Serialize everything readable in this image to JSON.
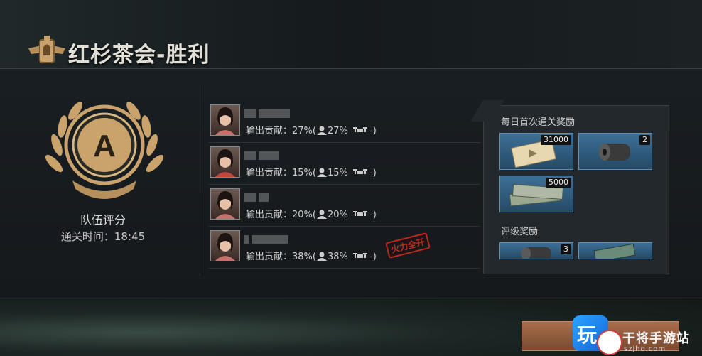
{
  "title": "红杉茶会-胜利",
  "team": {
    "grade": "A",
    "score_label": "队伍评分",
    "clear_time_label": "通关时间：",
    "clear_time": "18:45"
  },
  "players": [
    {
      "contrib_label": "输出贡献：",
      "output_pct": "27%",
      "personal_pct": "27%",
      "drone_val": "-"
    },
    {
      "contrib_label": "输出贡献：",
      "output_pct": "15%",
      "personal_pct": "15%",
      "drone_val": "-"
    },
    {
      "contrib_label": "输出贡献：",
      "output_pct": "20%",
      "personal_pct": "20%",
      "drone_val": "-"
    },
    {
      "contrib_label": "输出贡献：",
      "output_pct": "38%",
      "personal_pct": "38%",
      "drone_val": "-"
    }
  ],
  "badge": "火力全开",
  "rewards": {
    "first_clear_header": "每日首次通关奖励",
    "first_clear_items": [
      {
        "icon": "ticket-icon",
        "count": "31000"
      },
      {
        "icon": "film-roll-icon",
        "count": "2"
      },
      {
        "icon": "cash-stack-icon",
        "count": "5000"
      }
    ],
    "grade_header": "评级奖励",
    "grade_items": [
      {
        "icon": "film-roll-icon",
        "count": "3"
      },
      {
        "icon": "cash-bundle-icon",
        "count": ""
      }
    ]
  },
  "watermark": {
    "box_char": "玩",
    "title": "干将手游站",
    "url": "szjho.com"
  },
  "colors": {
    "accent_gold": "#c9a36b",
    "reward_blue": "#3d6f96",
    "badge_red": "#c02a20"
  }
}
